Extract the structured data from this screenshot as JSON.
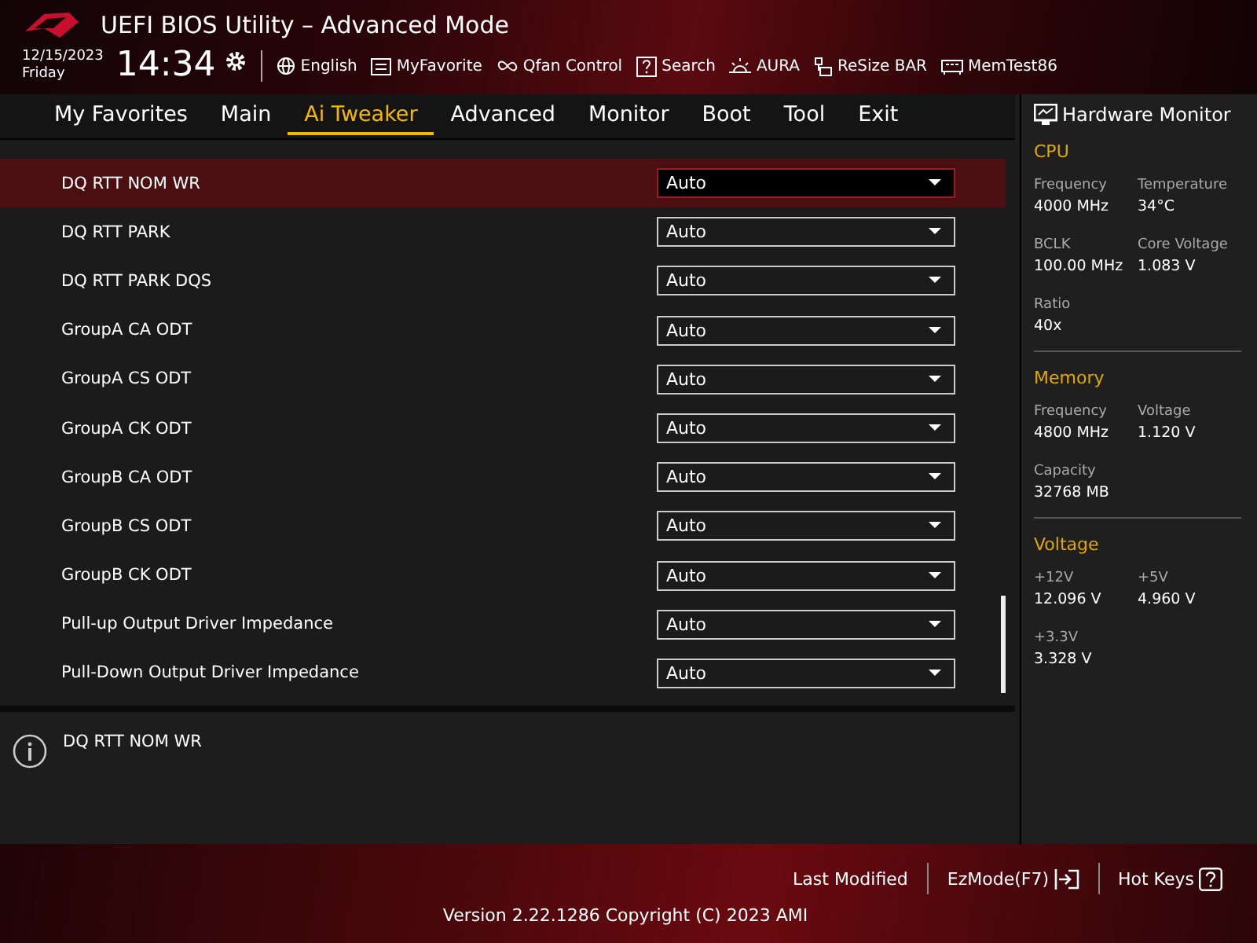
{
  "header": {
    "title": "UEFI BIOS Utility – Advanced Mode",
    "date": "12/15/2023",
    "day": "Friday",
    "time": "14:34",
    "tools": [
      {
        "kind": "globe",
        "label": "English"
      },
      {
        "kind": "favorite",
        "label": "MyFavorite"
      },
      {
        "kind": "fan",
        "label": "Qfan Control"
      },
      {
        "kind": "search",
        "label": "Search"
      },
      {
        "kind": "aura",
        "label": "AURA"
      },
      {
        "kind": "resize",
        "label": "ReSize BAR"
      },
      {
        "kind": "memtest",
        "label": "MemTest86"
      }
    ]
  },
  "tabs": [
    {
      "label": "My Favorites",
      "selected": false
    },
    {
      "label": "Main",
      "selected": false
    },
    {
      "label": "Ai Tweaker",
      "selected": true
    },
    {
      "label": "Advanced",
      "selected": false
    },
    {
      "label": "Monitor",
      "selected": false
    },
    {
      "label": "Boot",
      "selected": false
    },
    {
      "label": "Tool",
      "selected": false
    },
    {
      "label": "Exit",
      "selected": false
    }
  ],
  "settings": [
    {
      "label": "DQ RTT NOM WR",
      "value": "Auto",
      "selected": true
    },
    {
      "label": "DQ RTT PARK",
      "value": "Auto",
      "selected": false
    },
    {
      "label": "DQ RTT PARK DQS",
      "value": "Auto",
      "selected": false
    },
    {
      "label": "GroupA CA ODT",
      "value": "Auto",
      "selected": false
    },
    {
      "label": "GroupA CS ODT",
      "value": "Auto",
      "selected": false
    },
    {
      "label": "GroupA CK ODT",
      "value": "Auto",
      "selected": false
    },
    {
      "label": "GroupB CA ODT",
      "value": "Auto",
      "selected": false
    },
    {
      "label": "GroupB CS ODT",
      "value": "Auto",
      "selected": false
    },
    {
      "label": "GroupB CK ODT",
      "value": "Auto",
      "selected": false
    },
    {
      "label": "Pull-up Output Driver Impedance",
      "value": "Auto",
      "selected": false
    },
    {
      "label": "Pull-Down Output Driver Impedance",
      "value": "Auto",
      "selected": false
    }
  ],
  "help": {
    "text": "DQ RTT NOM WR"
  },
  "hardware_monitor": {
    "title": "Hardware Monitor",
    "sections": [
      {
        "title": "CPU",
        "fields": [
          {
            "label": "Frequency",
            "value": "4000 MHz"
          },
          {
            "label": "Temperature",
            "value": "34°C"
          },
          {
            "label": "BCLK",
            "value": "100.00 MHz"
          },
          {
            "label": "Core Voltage",
            "value": "1.083 V"
          },
          {
            "label": "Ratio",
            "value": "40x"
          }
        ]
      },
      {
        "title": "Memory",
        "fields": [
          {
            "label": "Frequency",
            "value": "4800 MHz"
          },
          {
            "label": "Voltage",
            "value": "1.120 V"
          },
          {
            "label": "Capacity",
            "value": "32768 MB"
          }
        ]
      },
      {
        "title": "Voltage",
        "fields": [
          {
            "label": "+12V",
            "value": "12.096 V"
          },
          {
            "label": "+5V",
            "value": "4.960 V"
          },
          {
            "label": "+3.3V",
            "value": "3.328 V"
          }
        ]
      }
    ]
  },
  "footer": {
    "buttons": [
      {
        "kind": "plain",
        "label": "Last Modified"
      },
      {
        "kind": "exit",
        "label": "EzMode(F7)"
      },
      {
        "kind": "help",
        "label": "Hot Keys"
      }
    ],
    "version": "Version 2.22.1286 Copyright (C) 2023 AMI"
  }
}
